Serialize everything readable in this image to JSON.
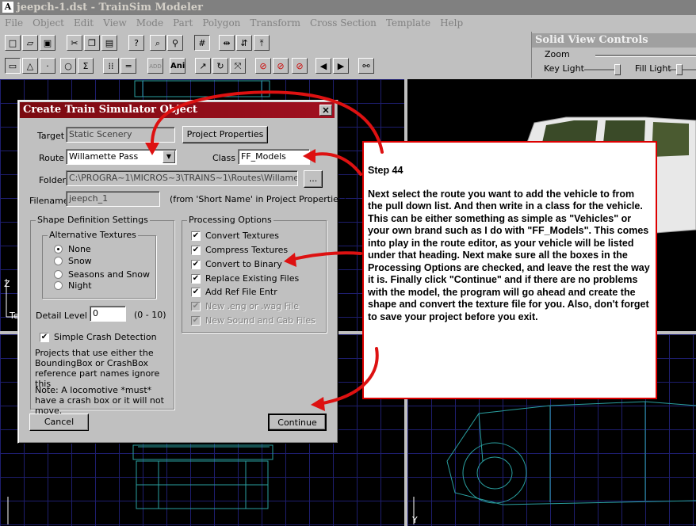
{
  "window": {
    "title": "jeepch-1.dst - TrainSim Modeler"
  },
  "menu": [
    "File",
    "Object",
    "Edit",
    "View",
    "Mode",
    "Part",
    "Polygon",
    "Transform",
    "Cross Section",
    "Template",
    "Help"
  ],
  "toolbar1": [
    "new-icon",
    "open-icon",
    "save-icon",
    "cut-icon",
    "copy-icon",
    "paste-icon",
    "help-icon",
    "zoom-in-icon",
    "zoom-out-icon",
    "grid-icon",
    "tool-x-icon",
    "tool-y-icon",
    "tool-z-icon"
  ],
  "toolbar2": [
    "rect-icon",
    "triangle-icon",
    "point-icon",
    "circle-icon",
    "sum-icon",
    "select-icon",
    "line-icon",
    "add-icon",
    "ani-icon",
    "arrow-icon",
    "rotate-icon",
    "scale-icon",
    "no1-icon",
    "no2-icon",
    "no3-icon",
    "prev-icon",
    "next-icon",
    "binoculars-icon"
  ],
  "toolbar_text": {
    "add": "ADD",
    "ani": "Ani"
  },
  "solid_view": {
    "title": "Solid View Controls",
    "zoom": "Zoom",
    "key_light": "Key Light",
    "fill_light": "Fill Light"
  },
  "viewports": {
    "axis_z": "Z",
    "axis_y": "Y",
    "axis_label_te": "Te"
  },
  "dialog": {
    "title": "Create Train Simulator Object",
    "target_label": "Target",
    "target_value": "Static Scenery",
    "project_properties": "Project Properties",
    "route_label": "Route",
    "route_value": "Willamette Pass",
    "class_label": "Class",
    "class_value": "FF_Models",
    "folder_label": "Folder",
    "folder_value": "C:\\PROGRA~1\\MICROS~3\\TRAINS~1\\Routes\\Willamette",
    "browse": "...",
    "filename_label": "Filename",
    "filename_value": "jeepch_1",
    "filename_note": "(from 'Short Name' in Project Properties)",
    "shape_group": "Shape Definition Settings",
    "alt_textures": "Alternative Textures",
    "radios": [
      "None",
      "Snow",
      "Seasons and Snow",
      "Night"
    ],
    "detail_label": "Detail Level",
    "detail_value": "0",
    "detail_range": "(0 - 10)",
    "crash_label": "Simple Crash Detection",
    "crash_note": "Projects that use either the BoundingBox or CrashBox reference part names ignore this",
    "loco_note": "Note: A locomotive *must* have a crash box or it will not move.",
    "processing_group": "Processing Options",
    "options": [
      {
        "label": "Convert Textures",
        "checked": "✔"
      },
      {
        "label": "Compress Textures",
        "checked": "✔"
      },
      {
        "label": "Convert to Binary",
        "checked": "✔"
      },
      {
        "label": "Replace Existing Files",
        "checked": "✔"
      },
      {
        "label": "Add Ref File Entr",
        "checked": "✔"
      },
      {
        "label": "New .eng or .wag File",
        "checked": "✔"
      },
      {
        "label": "New Sound and Cab Files",
        "checked": "✔"
      }
    ],
    "cancel": "Cancel",
    "continue": "Continue"
  },
  "callout": {
    "step": "Step 44",
    "body": "Next select the route you want to add the vehicle to from the pull down list. And then write in a class for the vehicle. This can be either something as simple as \"Vehicles\" or your own brand such as I do with \"FF_Models\". This comes into play in the route editor, as your vehicle will be listed under that heading. Next make sure all the boxes in the Processing Options are checked, and leave the rest the way it is. Finally click \"Continue\" and if there are no problems with the model, the program will go ahead and create the shape and convert the texture file for you. Also, don't forget to save your project before you exit."
  },
  "colors": {
    "annotation_red": "#dd1111",
    "title_red": "#8b0a14",
    "viewport_bg": "#000000",
    "wireframe": "#2aa0a0"
  }
}
